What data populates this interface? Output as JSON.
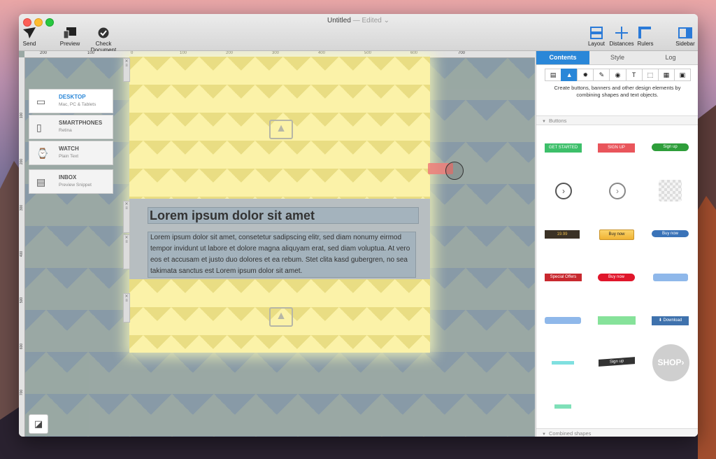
{
  "window": {
    "title": "Untitled",
    "edited": "Edited"
  },
  "toolbar": {
    "left": [
      {
        "label": "Send",
        "icon": "paper-plane-icon"
      },
      {
        "label": "Preview",
        "icon": "devices-icon"
      },
      {
        "label": "Check Document",
        "icon": "checkmark-icon"
      }
    ],
    "right": [
      {
        "label": "Layout",
        "icon": "layout-icon"
      },
      {
        "label": "Distances",
        "icon": "distances-icon"
      },
      {
        "label": "Rulers",
        "icon": "rulers-icon"
      },
      {
        "label": "Sidebar",
        "icon": "sidebar-icon"
      }
    ]
  },
  "ruler": {
    "ticks": [
      "200",
      "100",
      "0",
      "100",
      "200",
      "300",
      "400",
      "500",
      "600",
      "700"
    ],
    "vticks": [
      "100",
      "200",
      "300",
      "400",
      "500",
      "600",
      "700"
    ]
  },
  "devices": [
    {
      "name": "DESKTOP",
      "sub": "Mac, PC & Tablets",
      "selected": true
    },
    {
      "name": "SMARTPHONES",
      "sub": "Retina"
    },
    {
      "name": "WATCH",
      "sub": "Plain Text"
    },
    {
      "name": "INBOX",
      "sub": "Preview Snippet"
    }
  ],
  "document": {
    "heading": "Lorem ipsum dolor sit amet",
    "paragraph": "Lorem ipsum dolor sit amet, consetetur sadipscing elitr, sed diam nonumy eirmod tempor invidunt ut labore et dolore magna aliquyam erat, sed diam voluptua. At vero eos et accusam et justo duo dolores et ea rebum. Stet clita kasd gubergren, no sea takimata sanctus est Lorem ipsum dolor sit amet."
  },
  "sidebar": {
    "tabs": [
      "Contents",
      "Style",
      "Log"
    ],
    "description": "Create buttons, banners and other design elements by combining shapes and text objects.",
    "sections": {
      "buttons": "Buttons",
      "combined": "Combined shapes"
    },
    "buttons": {
      "get_started": "GET STARTED",
      "sign_up_red": "SIGN UP",
      "sign_up_green": "Sign up",
      "price": "19.99",
      "buy_now_amazon": "Buy now",
      "buy_now_blue": "Buy now",
      "special_offers": "Special Offers",
      "buy_now_red": "Buy now",
      "download": "Download",
      "sign_up_dark": "Sign up",
      "shop": "SHOP"
    }
  },
  "colors": {
    "accent": "#2a87d8",
    "green": "#3dbf6a",
    "red": "#e9555b"
  }
}
